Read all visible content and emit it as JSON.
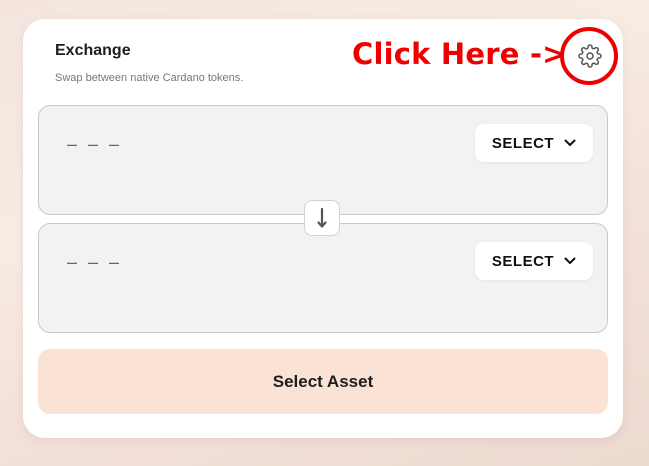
{
  "header": {
    "title": "Exchange",
    "subtitle": "Swap between native Cardano tokens."
  },
  "annotation": {
    "text": "Click Here ->",
    "color": "#ee0000"
  },
  "settings": {
    "icon": "gear-icon"
  },
  "from_panel": {
    "amount_placeholder": "– – –",
    "select_label": "SELECT",
    "select_icon": "chevron-down-icon"
  },
  "swap": {
    "icon": "arrow-down-icon"
  },
  "to_panel": {
    "amount_placeholder": "– – –",
    "select_label": "SELECT",
    "select_icon": "chevron-down-icon"
  },
  "action": {
    "label": "Select Asset",
    "background": "#fae3d4"
  }
}
